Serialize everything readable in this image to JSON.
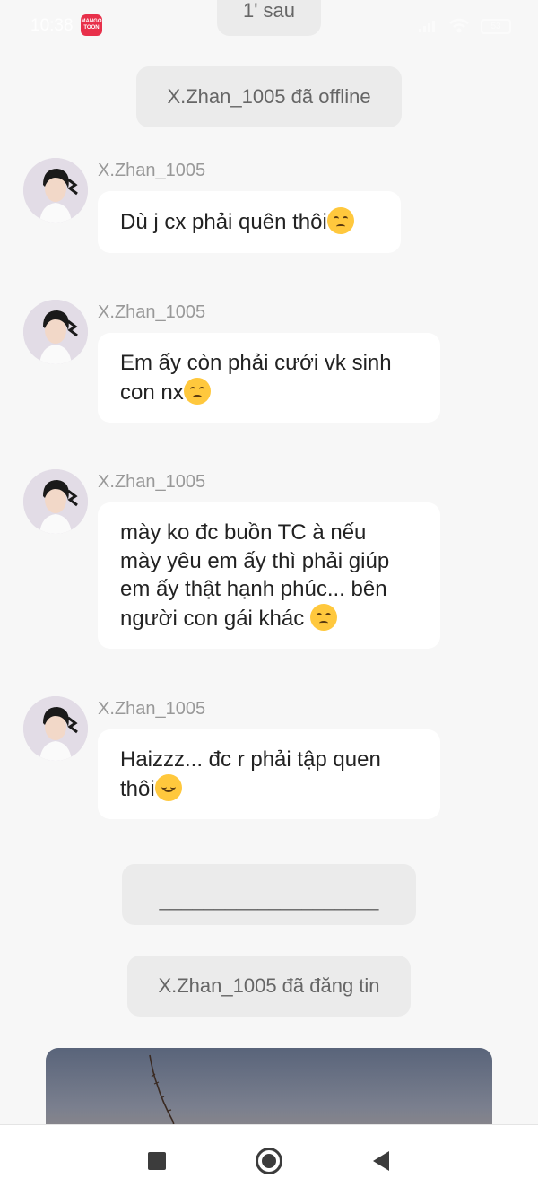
{
  "status_bar": {
    "time": "10:38",
    "app_badge_line1": "MANGO",
    "app_badge_line2": "TOON",
    "battery": "53"
  },
  "system_messages": {
    "top_partial": "1' sau",
    "offline": "X.Zhan_1005 đã offline",
    "divider": "____________________",
    "posted": "X.Zhan_1005 đã đăng tin"
  },
  "messages": [
    {
      "sender": "X.Zhan_1005",
      "text": "Dù j cx phải quên thôi",
      "emoji": "disappointed-face"
    },
    {
      "sender": "X.Zhan_1005",
      "text_lines": [
        "Em ấy còn phải cưới vk sinh",
        "con nx"
      ],
      "emoji": "disappointed-face"
    },
    {
      "sender": "X.Zhan_1005",
      "text_lines": [
        "mày ko đc buồn TC à nếu",
        "mày yêu em ấy thì phải giúp",
        "em ấy thật hạnh phúc... bên",
        "người con gái khác "
      ],
      "emoji": "disappointed-face"
    },
    {
      "sender": "X.Zhan_1005",
      "text_lines": [
        "Haizzz... đc r phải tập quen",
        "thôi"
      ],
      "emoji": "relieved-face"
    }
  ],
  "colors": {
    "background": "#f7f7f7",
    "bubble": "#ffffff",
    "pill": "#ebebeb",
    "sender": "#999999"
  }
}
